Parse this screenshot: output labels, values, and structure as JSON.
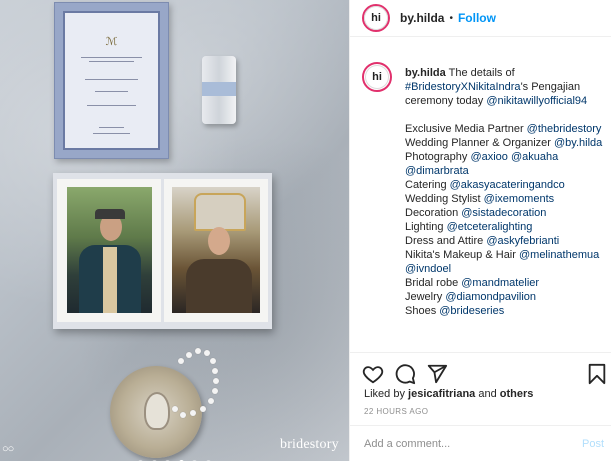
{
  "photo": {
    "brand_watermark": "bridestory",
    "carousel_count": 6,
    "carousel_active": 3
  },
  "header": {
    "avatar_text": "hi",
    "username": "by.hilda",
    "separator": "•",
    "follow_label": "Follow"
  },
  "caption": {
    "avatar_text": "hi",
    "username": "by.hilda",
    "intro": "The details of",
    "hashtag": "#BridestoryXNikitaIndra",
    "intro_rest": "'s Pengajian ceremony today",
    "mention_main": "@nikitawillyofficial94",
    "lines": [
      {
        "label": "Exclusive Media Partner",
        "handle": "@thebridestory"
      },
      {
        "label": "Wedding Planner & Organizer",
        "handle": "@by.hilda"
      },
      {
        "label": "Photography",
        "handle": "@axioo @akuaha @dimarbrata"
      },
      {
        "label": "Catering",
        "handle": "@akasyacateringandco"
      },
      {
        "label": "Wedding Stylist",
        "handle": "@ixemoments"
      },
      {
        "label": "Decoration",
        "handle": "@sistadecoration"
      },
      {
        "label": "Lighting",
        "handle": "@etceteralighting"
      },
      {
        "label": "Dress and Attire",
        "handle": "@askyfebrianti"
      },
      {
        "label": "Nikita's Makeup & Hair",
        "handle": "@melinathemua @ivndoel"
      },
      {
        "label": "Bridal robe",
        "handle": "@mandmatelier"
      },
      {
        "label": "Jewelry",
        "handle": "@diamondpavilion"
      },
      {
        "label": "Shoes",
        "handle": "@brideseries"
      }
    ]
  },
  "actions": {
    "like_icon": "heart-icon",
    "comment_icon": "comment-icon",
    "share_icon": "share-icon",
    "save_icon": "bookmark-icon"
  },
  "likes": {
    "prefix": "Liked by",
    "user": "jesicafitriana",
    "and": "and",
    "others": "others"
  },
  "timestamp": "22 HOURS AGO",
  "comment": {
    "placeholder": "Add a comment...",
    "post_label": "Post"
  }
}
